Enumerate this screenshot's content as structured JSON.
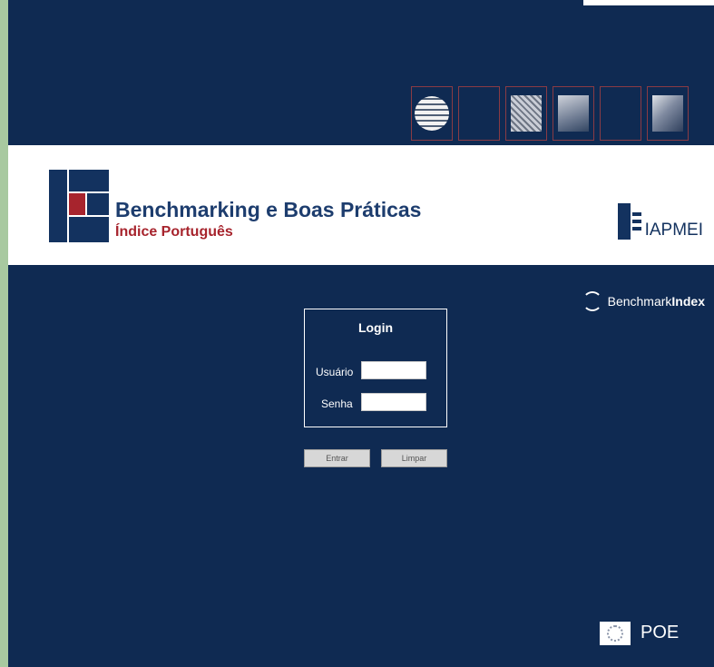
{
  "header": {
    "thumbnails": [
      {
        "name": "globe-image"
      },
      {
        "name": "blank-image"
      },
      {
        "name": "circuit-image"
      },
      {
        "name": "factory-image"
      },
      {
        "name": "blank-image"
      },
      {
        "name": "tools-image"
      }
    ]
  },
  "brand": {
    "title": "Benchmarking e Boas Práticas",
    "subtitle": "Índice Português",
    "partner": "IAPMEI"
  },
  "benchmark_index": {
    "prefix": "Benchmark",
    "suffix": "Index"
  },
  "login": {
    "title": "Login",
    "user_label": "Usuário",
    "user_value": "",
    "password_label": "Senha",
    "password_value": ""
  },
  "actions": {
    "submit_label": "Entrar",
    "clear_label": "Limpar"
  },
  "footer": {
    "poe_label": "POE"
  },
  "colors": {
    "navy": "#0f2a52",
    "brand_blue": "#1d3d6e",
    "brand_red": "#a7242d",
    "side_green": "#a8c9a0"
  }
}
